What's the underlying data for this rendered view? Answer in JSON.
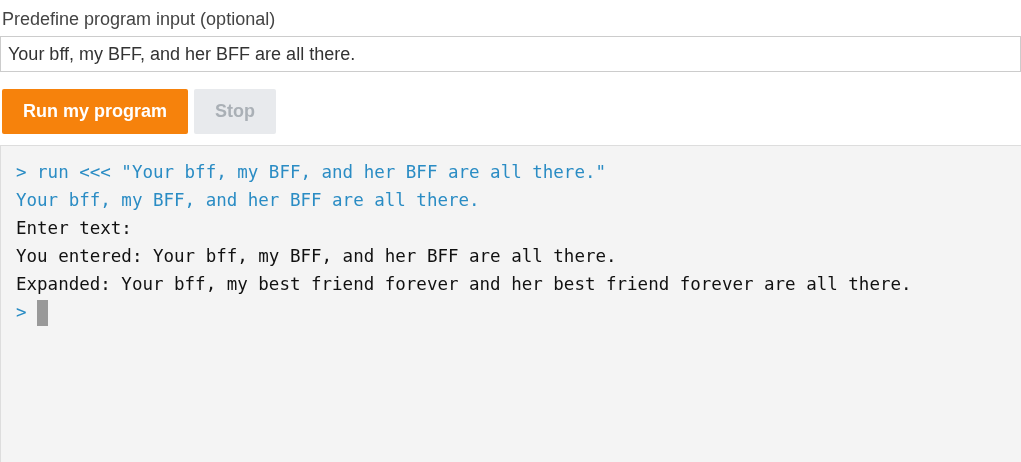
{
  "input_label": "Predefine program input (optional)",
  "input_value": "Your bff, my BFF, and her BFF are all there.",
  "buttons": [
    {
      "label": "Run my program",
      "disabled": false
    },
    {
      "label": "Stop",
      "disabled": true
    }
  ],
  "console": {
    "lines": [
      {
        "kind": "echo",
        "text": "> run <<< \"Your bff, my BFF, and her BFF are all there.\""
      },
      {
        "kind": "echo",
        "text": "Your bff, my BFF, and her BFF are all there."
      },
      {
        "kind": "output",
        "text": "Enter text:"
      },
      {
        "kind": "output",
        "text": "You entered: Your bff, my BFF, and her BFF are all there."
      },
      {
        "kind": "output",
        "text": "Expanded: Your bff, my best friend forever and her best friend forever are all there."
      }
    ],
    "prompt": ">"
  }
}
